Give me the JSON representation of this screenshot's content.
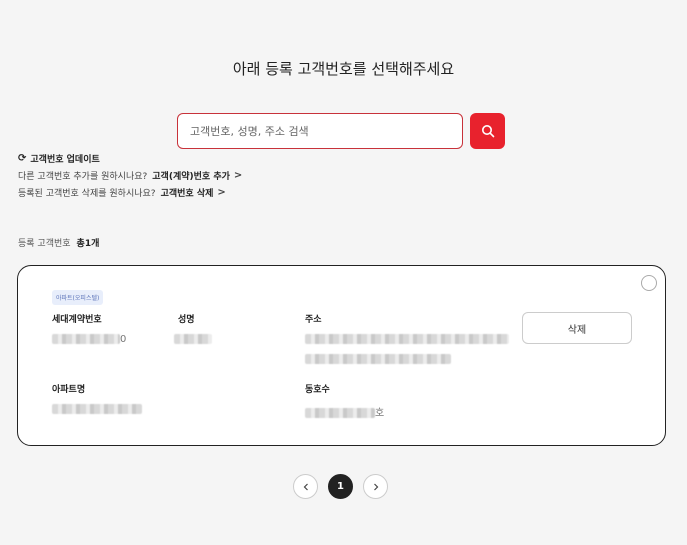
{
  "page": {
    "title": "아래 등록 고객번호를 선택해주세요"
  },
  "search": {
    "placeholder": "고객번호, 성명, 주소 검색",
    "button_icon": "search-icon",
    "accent": "#e8222d"
  },
  "links": {
    "refresh_label": "고객번호 업데이트",
    "add_prompt": "다른 고객번호 추가를 원하시나요?",
    "add_link": "고객(계약)번호 추가",
    "delete_prompt": "등록된 고객번호 삭제를 원하시나요?",
    "delete_link": "고객번호 삭제"
  },
  "summary": {
    "label": "등록 고객번호",
    "count": "총1개"
  },
  "card": {
    "badge": "아파트(오피스텔)",
    "labels": {
      "contract": "세대계약번호",
      "name": "성명",
      "address": "주소",
      "apartment": "아파트명",
      "unit": "동호수"
    },
    "values": {
      "contract_suffix": "0",
      "unit_suffix": "호"
    },
    "delete_button": "삭제"
  },
  "pagination": {
    "current": "1",
    "prev_icon": "chevron-left-icon",
    "next_icon": "chevron-right-icon"
  }
}
